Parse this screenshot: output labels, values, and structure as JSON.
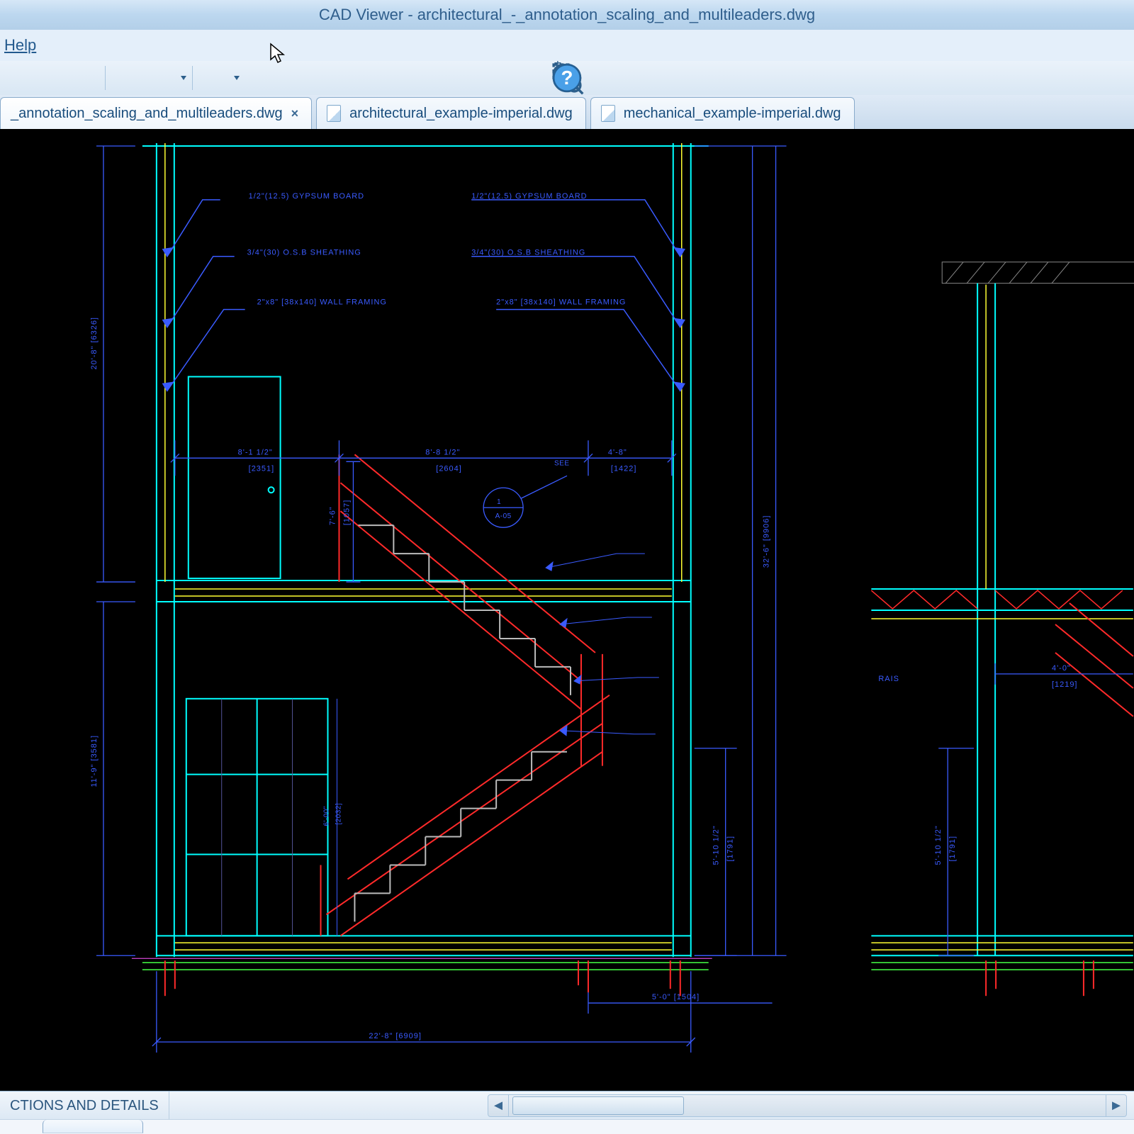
{
  "app": {
    "title": "CAD Viewer - architectural_-_annotation_scaling_and_multileaders.dwg"
  },
  "menu": {
    "help": "Help"
  },
  "toolbar": {
    "zoom_window": "zoom-window",
    "zoom_in": "zoom-in",
    "zoom_out": "zoom-out",
    "orbit": "orbit",
    "globe": "view-3d",
    "help": "help"
  },
  "tabs": [
    {
      "label": "_annotation_scaling_and_multileaders.dwg",
      "active": true
    },
    {
      "label": "architectural_example-imperial.dwg",
      "active": false
    },
    {
      "label": "mechanical_example-imperial.dwg",
      "active": false
    }
  ],
  "footer": {
    "panel_label": "CTIONS AND DETAILS"
  },
  "drawing": {
    "leaders_left": [
      "1/2\"(12.5) GYPSUM BOARD",
      "3/4\"(30) O.S.B SHEATHING",
      "2\"x8\" [38x140] WALL FRAMING"
    ],
    "leaders_right": [
      "1/2\"(12.5) GYPSUM BOARD",
      "3/4\"(30) O.S.B SHEATHING",
      "2\"x8\" [38x140] WALL FRAMING"
    ],
    "dim_upper_left": "8'-1 1/2\"",
    "dim_upper_left2": "[2351]",
    "dim_upper_mid": "8'-8 1/2\"",
    "dim_upper_mid2": "[2604]",
    "dim_upper_right": "4'-8\"",
    "dim_upper_right2": "[1422]",
    "dim_stair_h": "7'-6\"",
    "dim_stair_h2": "[1057]",
    "dim_left_upper": "20'-8\" [6326]",
    "dim_left_lower": "11'-9\" [3581]",
    "dim_right_total": "32'-6\" [9906]",
    "dim_bottom_total": "22'-8\" [6909]",
    "dim_bottom_right": "5'-0\" [1504]",
    "dim_right_lower": "5'-10 1/2\"",
    "dim_right_lower2": "[1791]",
    "dim_door": "6'-00\"",
    "dim_door2": "[2032]",
    "callout": "SEE 1 A-05",
    "right_view": {
      "dim_w": "4'-0\"",
      "dim_w2": "[1219]",
      "dim_h": "5'-10 1/2\"",
      "dim_h2": "[1791]",
      "label": "RAIS"
    }
  }
}
